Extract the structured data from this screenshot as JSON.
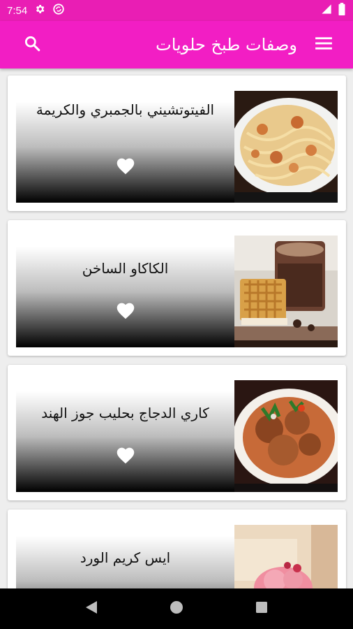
{
  "status_bar": {
    "time": "7:54"
  },
  "app_bar": {
    "title": "وصفات طبخ حلويات"
  },
  "recipes": [
    {
      "title": "الفيتوتشيني بالجمبري والكريمة"
    },
    {
      "title": "الكاكاو الساخن"
    },
    {
      "title": "كاري الدجاج بحليب جوز الهند"
    },
    {
      "title": "ايس كريم الورد"
    }
  ],
  "colors": {
    "status_bar": "#e91eb4",
    "app_bar": "#f21ec4",
    "heart": "#ffffff"
  },
  "icons": [
    "settings-icon",
    "sync-icon",
    "signal-icon",
    "battery-icon",
    "menu-icon",
    "search-icon",
    "heart-icon",
    "back-icon",
    "home-icon",
    "recents-icon"
  ]
}
